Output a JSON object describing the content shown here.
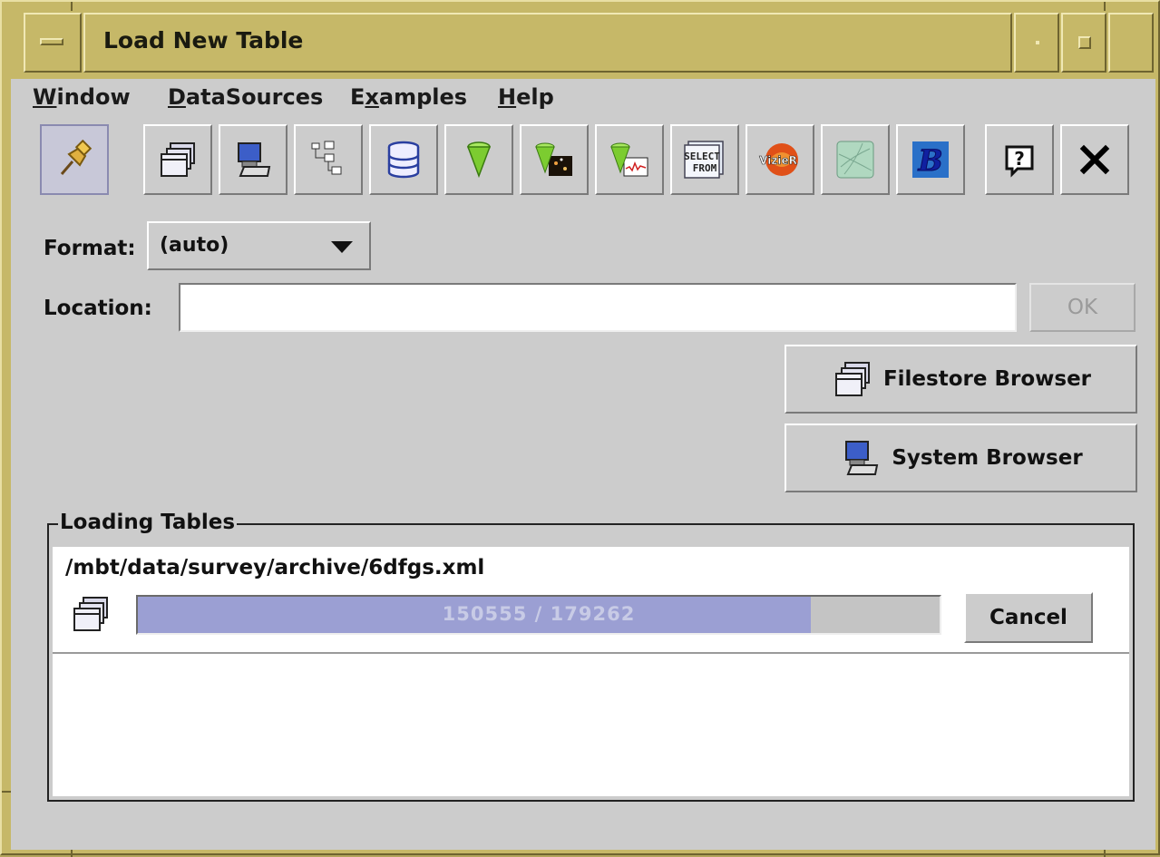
{
  "window": {
    "title": "Load New Table"
  },
  "menu": [
    {
      "label": "Window",
      "mnemonic": "W",
      "rest": "indow"
    },
    {
      "label": "DataSources",
      "mnemonic": "D",
      "rest": "ataSources"
    },
    {
      "label": "Examples",
      "pre": "E",
      "mnemonic": "x",
      "rest": "amples"
    },
    {
      "label": "Help",
      "mnemonic": "H",
      "rest": "elp"
    }
  ],
  "toolbar": [
    {
      "name": "pin-icon",
      "selected": true
    },
    {
      "name": "filestore-icon"
    },
    {
      "name": "system-browser-icon"
    },
    {
      "name": "hierarchy-icon"
    },
    {
      "name": "database-icon"
    },
    {
      "name": "cone-icon"
    },
    {
      "name": "cone-sky-icon"
    },
    {
      "name": "cone-spectrum-icon"
    },
    {
      "name": "sql-select-icon",
      "text": "SELECT FROM"
    },
    {
      "name": "vizier-icon",
      "text": "VizieR"
    },
    {
      "name": "sky-map-icon"
    },
    {
      "name": "bibcode-icon",
      "text": "B"
    },
    {
      "name": "help-icon",
      "text": "?"
    },
    {
      "name": "close-icon"
    }
  ],
  "form": {
    "format_label": "Format:",
    "format_value": "(auto)",
    "location_label": "Location:",
    "location_value": "",
    "ok_label": "OK"
  },
  "browsers": {
    "filestore_label": "Filestore Browser",
    "system_label": "System Browser"
  },
  "loading": {
    "group_title": "Loading Tables",
    "path": "/mbt/data/survey/archive/6dfgs.xml",
    "progress_text": "150555 / 179262",
    "progress_fraction": 0.8399,
    "cancel_label": "Cancel"
  },
  "colors": {
    "frame": "#c6b868",
    "panel": "#cccccc",
    "progress_fill": "#9b9fd3"
  }
}
